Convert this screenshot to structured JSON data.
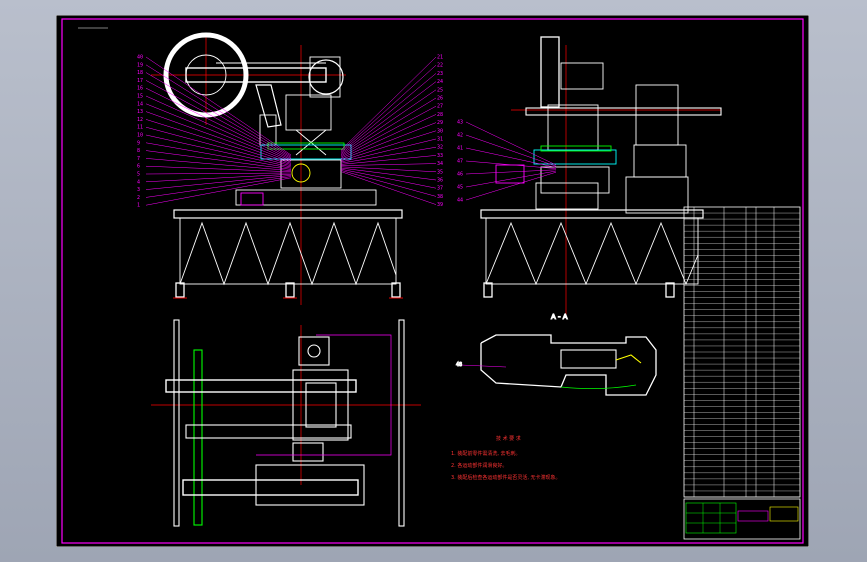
{
  "drawing": {
    "section_label": "A - A",
    "notes_title": "技 术 要 求",
    "notes": [
      "1. 装配前零件需清洗, 去毛刺。",
      "2. 各运动部件润滑良好。",
      "3. 装配后检查各运动部件是否灵活, 无卡滞现象。"
    ],
    "front_labels_left": [
      "40",
      "19",
      "18",
      "17",
      "16",
      "15",
      "14",
      "13",
      "12",
      "11",
      "10",
      "9",
      "8",
      "7",
      "6",
      "5",
      "4",
      "3",
      "2",
      "1"
    ],
    "front_labels_right": [
      "21",
      "22",
      "23",
      "24",
      "25",
      "26",
      "27",
      "28",
      "29",
      "30",
      "31",
      "32",
      "33",
      "34",
      "35",
      "36",
      "37",
      "38",
      "39"
    ],
    "side_labels": [
      "43",
      "42",
      "41",
      "47",
      "46",
      "45",
      "44"
    ],
    "detail_label": "48",
    "colors": {
      "frame": "#ff00ff",
      "part": "#ffffff",
      "center": "#ff0000",
      "leader": "#ff00ff",
      "accent": "#00ff00",
      "highlight": "#ffff00"
    }
  }
}
